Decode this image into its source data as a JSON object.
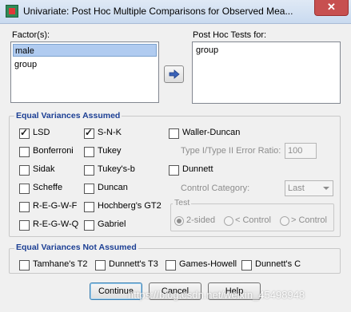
{
  "window": {
    "title": "Univariate: Post Hoc Multiple Comparisons for Observed Mea...",
    "close_glyph": "✕"
  },
  "factors": {
    "label": "Factor(s):",
    "items": [
      "male",
      "group"
    ],
    "selected": "male"
  },
  "post_hoc": {
    "label": "Post Hoc Tests for:",
    "items": [
      "group"
    ]
  },
  "equal_assumed": {
    "title": "Equal Variances Assumed",
    "col1": [
      {
        "label": "LSD",
        "checked": true
      },
      {
        "label": "Bonferroni",
        "checked": false
      },
      {
        "label": "Sidak",
        "checked": false
      },
      {
        "label": "Scheffe",
        "checked": false
      },
      {
        "label": "R-E-G-W-F",
        "checked": false
      },
      {
        "label": "R-E-G-W-Q",
        "checked": false
      }
    ],
    "col2": [
      {
        "label": "S-N-K",
        "checked": true
      },
      {
        "label": "Tukey",
        "checked": false
      },
      {
        "label": "Tukey's-b",
        "checked": false
      },
      {
        "label": "Duncan",
        "checked": false
      },
      {
        "label": "Hochberg's GT2",
        "checked": false
      },
      {
        "label": "Gabriel",
        "checked": false
      }
    ],
    "waller": {
      "label": "Waller-Duncan",
      "checked": false
    },
    "ratio_label": "Type I/Type II Error Ratio:",
    "ratio_value": "100",
    "dunnett": {
      "label": "Dunnett",
      "checked": false
    },
    "control_label": "Control Category:",
    "control_value": "Last",
    "test_title": "Test",
    "test_options": [
      "2-sided",
      "< Control",
      "> Control"
    ],
    "test_selected": "2-sided"
  },
  "equal_not_assumed": {
    "title": "Equal Variances Not Assumed",
    "items": [
      {
        "label": "Tamhane's T2",
        "checked": false
      },
      {
        "label": "Dunnett's T3",
        "checked": false
      },
      {
        "label": "Games-Howell",
        "checked": false
      },
      {
        "label": "Dunnett's C",
        "checked": false
      }
    ]
  },
  "buttons": {
    "continue": "Continue",
    "cancel": "Cancel",
    "help": "Help"
  },
  "watermark": "https://blog.csdn.net/weixin_45498948",
  "colors": {
    "group_title": "#1c3f94",
    "selection": "#b0cbf0",
    "close_button": "#c75050"
  }
}
